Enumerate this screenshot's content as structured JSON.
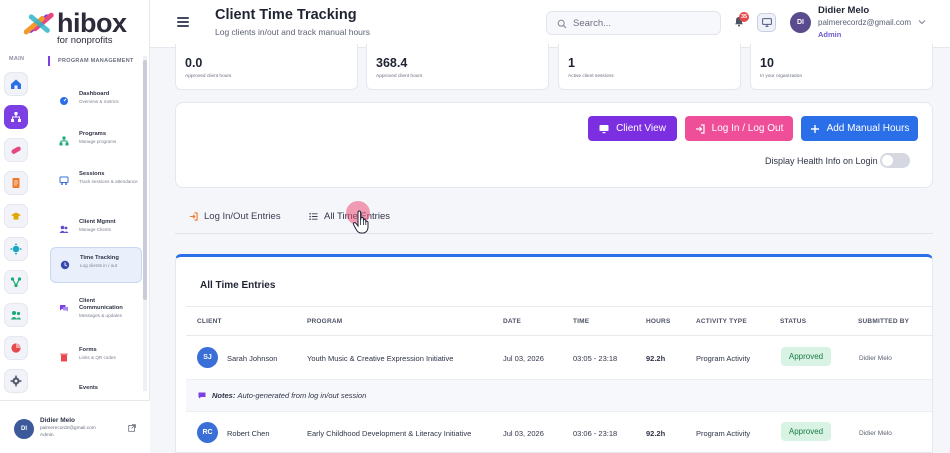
{
  "brand": {
    "name": "hibox",
    "tagline": "for nonprofits"
  },
  "sidebar": {
    "rail_label": "MAIN",
    "section_title": "PROGRAM MANAGEMENT",
    "items": [
      {
        "title": "Dashboard",
        "sub": "Overview & metrics"
      },
      {
        "title": "Programs",
        "sub": "Manage programs"
      },
      {
        "title": "Sessions",
        "sub": "Track sessions & attendance"
      },
      {
        "title": "Client Mgmnt",
        "sub": "Manage Clients"
      },
      {
        "title": "Time Tracking",
        "sub": "Log clients in / out"
      },
      {
        "title": "Client Communication",
        "sub": "Messages & updates"
      },
      {
        "title": "Forms",
        "sub": "Links & QR codes"
      },
      {
        "title": "Events",
        "sub": ""
      }
    ],
    "user": {
      "initials": "DI",
      "name": "Didier Melo",
      "email": "palmerecordz@gmail.com",
      "role": "Admin"
    }
  },
  "header": {
    "title": "Client Time Tracking",
    "subtitle": "Log clients in/out and track manual hours",
    "search_placeholder": "Search...",
    "notification_count": "35",
    "user": {
      "initials": "DI",
      "name": "Didier Melo",
      "email": "palmerecordz@gmail.com",
      "role": "Admin"
    }
  },
  "stats": [
    {
      "value": "0.0",
      "label": "Approved client hours"
    },
    {
      "value": "368.4",
      "label": "Approved client hours"
    },
    {
      "value": "1",
      "label": "Active client sessions"
    },
    {
      "value": "10",
      "label": "In your organization"
    }
  ],
  "actions": {
    "client_view": "Client View",
    "log_in_out": "Log In / Log Out",
    "add_manual": "Add Manual Hours",
    "health_toggle_label": "Display Health Info on Login",
    "health_toggle_on": false
  },
  "tabs": {
    "log_entries": "Log In/Out Entries",
    "all_entries": "All Time Entries"
  },
  "table": {
    "title": "All Time Entries",
    "columns": [
      "CLIENT",
      "PROGRAM",
      "DATE",
      "TIME",
      "HOURS",
      "ACTIVITY TYPE",
      "STATUS",
      "SUBMITTED BY"
    ],
    "rows": [
      {
        "initials": "SJ",
        "client": "Sarah Johnson",
        "program": "Youth Music & Creative Expression Initiative",
        "date": "Jul 03, 2026",
        "time": "03:05 - 23:18",
        "hours": "92.2h",
        "activity": "Program Activity",
        "status": "Approved",
        "submitted_by": "Didier Melo"
      },
      {
        "initials": "RC",
        "client": "Robert Chen",
        "program": "Early Childhood Development & Literacy Initiative",
        "date": "Jul 03, 2026",
        "time": "03:06 - 23:18",
        "hours": "92.2h",
        "activity": "Program Activity",
        "status": "Approved",
        "submitted_by": "Didier Melo"
      }
    ],
    "note": {
      "label": "Notes:",
      "text": "Auto-generated from log in/out session"
    }
  },
  "colors": {
    "accent_purple": "#7b2fe0",
    "accent_pink": "#ef4f99",
    "accent_blue": "#2b6fe8",
    "status_green": "#d8f3e4"
  }
}
